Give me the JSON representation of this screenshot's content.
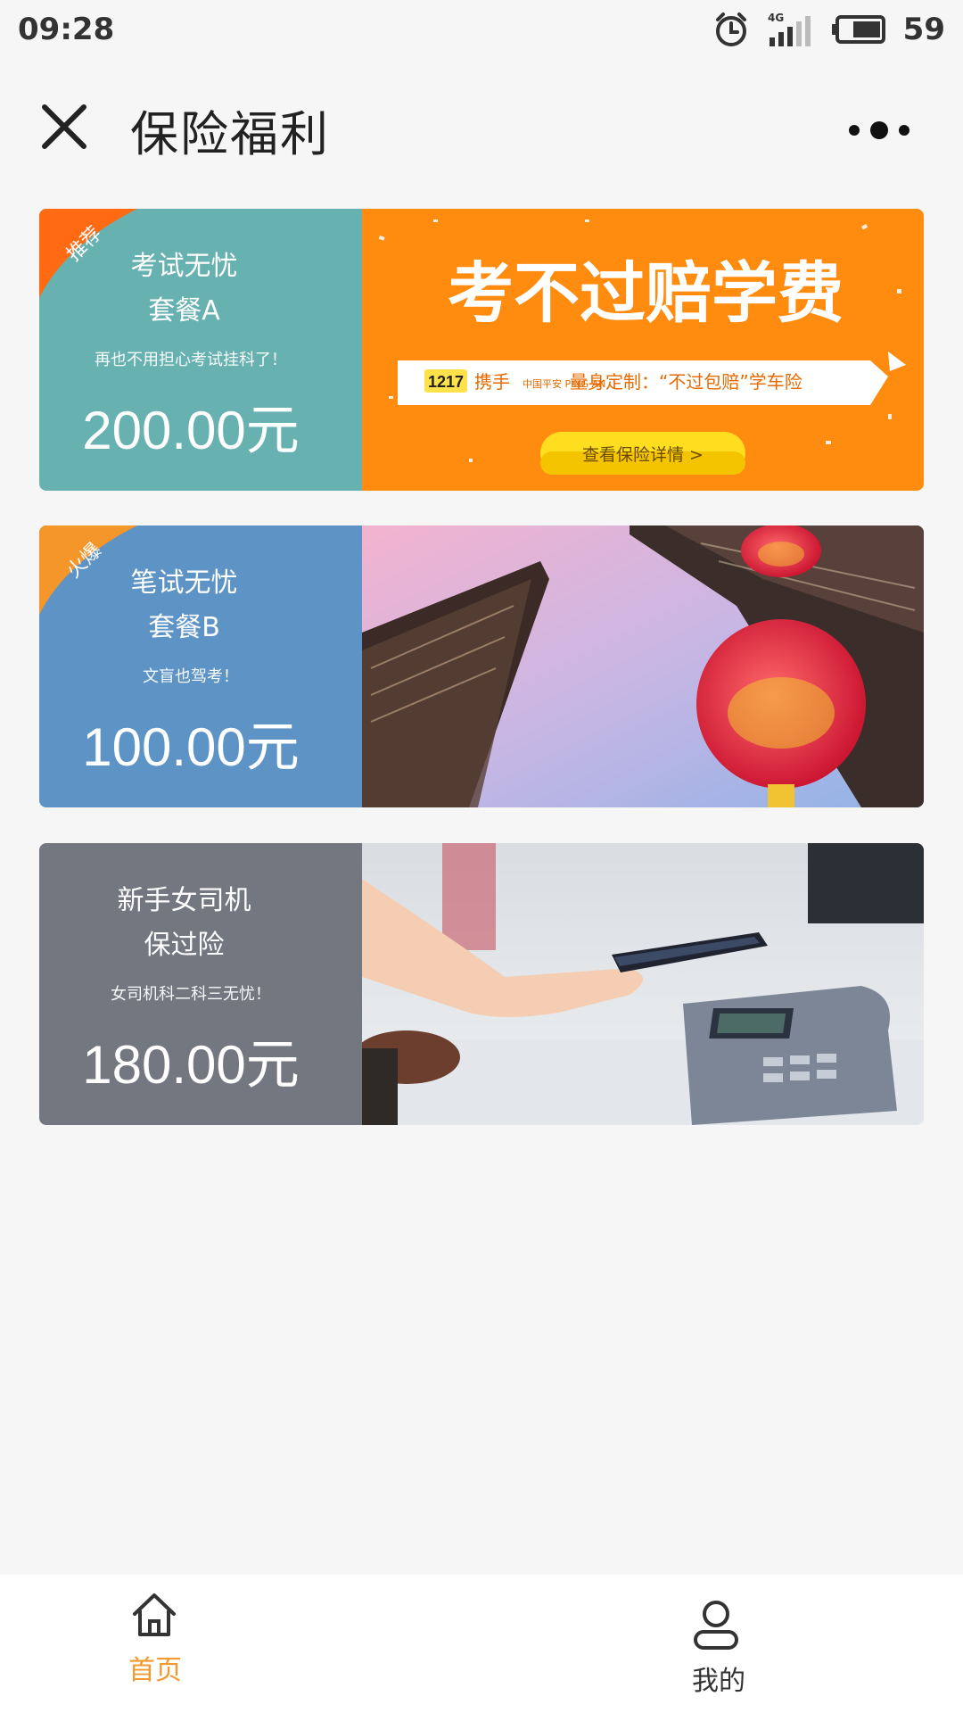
{
  "status_bar": {
    "time": "09:28",
    "network": "4G",
    "battery": "59",
    "icons": [
      "alarm-icon",
      "signal-icon",
      "battery-icon"
    ]
  },
  "header": {
    "title": "保险福利",
    "close_icon": "close-icon",
    "more_icon": "more-icon"
  },
  "cards": [
    {
      "badge": "推荐",
      "name_line1": "考试无忧",
      "name_line2": "套餐A",
      "desc": "再也不用担心考试挂科了！",
      "price": "200.00元",
      "left_color": "#67b2b1",
      "banner": {
        "headline": "考不过赔学费",
        "partner_logo": "1217",
        "with": "携手",
        "insurer": "中国平安 PING AN",
        "slogan": "量身定制：“不过包赔”学车险",
        "button": "查看保险详情 >",
        "bg_color": "#ff8b0f"
      }
    },
    {
      "badge": "火爆",
      "name_line1": "笔试无忧",
      "name_line2": "套餐B",
      "desc": "文盲也驾考！",
      "price": "100.00元",
      "left_color": "#5e94c5",
      "banner": {
        "scene": "chinese-pavilion-lanterns"
      }
    },
    {
      "badge": "",
      "name_line1": "新手女司机",
      "name_line2": "保过险",
      "desc": "女司机科二科三无忧！",
      "price": "180.00元",
      "left_color": "#737780",
      "banner": {
        "scene": "phone-payment-terminal"
      }
    }
  ],
  "tab_bar": {
    "tabs": [
      {
        "label": "首页",
        "icon": "home-icon",
        "active": true
      },
      {
        "label": "我的",
        "icon": "user-icon",
        "active": false
      }
    ],
    "active_color": "#f29a2e",
    "inactive_color": "#333333"
  }
}
